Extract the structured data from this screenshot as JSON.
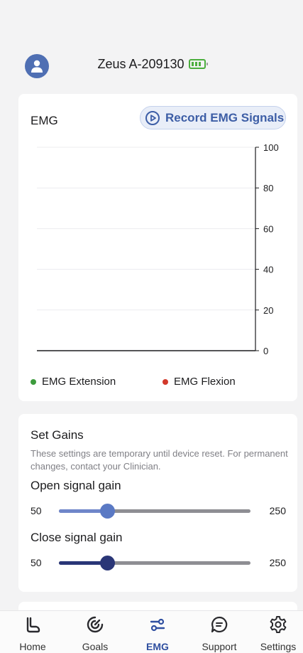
{
  "header": {
    "device_name": "Zeus A-209130",
    "avatar_icon": "user-avatar-icon",
    "battery_icon": "battery-icon",
    "battery_color": "#4cae3e"
  },
  "emg_card": {
    "title": "EMG",
    "record_button_label": "Record EMG Signals",
    "record_icon": "play-circle-icon"
  },
  "chart_data": {
    "type": "line",
    "title": "",
    "xlabel": "",
    "ylabel": "",
    "ylim": [
      0,
      100
    ],
    "y_ticks": [
      "100",
      "80",
      "60",
      "40",
      "20",
      "0"
    ],
    "y_axis_side": "right",
    "grid": true,
    "series": [
      {
        "name": "EMG Extension",
        "color": "#3d9b3d",
        "values": []
      },
      {
        "name": "EMG Flexion",
        "color": "#d2392b",
        "values": []
      }
    ],
    "legend": "bottom"
  },
  "gains": {
    "title": "Set Gains",
    "note": "These settings are temporary until device reset. For permanent changes, contact your Clinician.",
    "sliders": [
      {
        "label": "Open signal gain",
        "min": "50",
        "max": "250",
        "value": 100,
        "fraction": 0.25,
        "color": "#5a79c4",
        "fill_color": "#6f86c9"
      },
      {
        "label": "Close signal gain",
        "min": "50",
        "max": "250",
        "value": 100,
        "fraction": 0.25,
        "color": "#2a3677",
        "fill_color": "#2a3677"
      }
    ]
  },
  "nav": {
    "active": "EMG",
    "accent": "#2f4fa0",
    "items": [
      {
        "label": "Home",
        "icon": "hand-icon"
      },
      {
        "label": "Goals",
        "icon": "target-icon"
      },
      {
        "label": "EMG",
        "icon": "sliders-icon"
      },
      {
        "label": "Support",
        "icon": "chat-icon"
      },
      {
        "label": "Settings",
        "icon": "gear-icon"
      }
    ]
  }
}
